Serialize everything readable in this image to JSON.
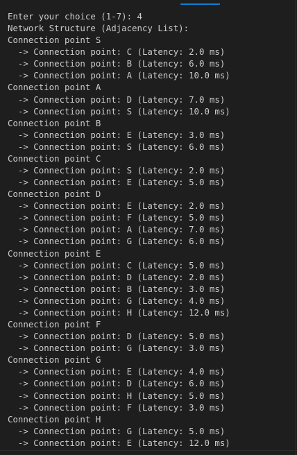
{
  "terminal": {
    "lines": [
      "Enter your choice (1-7): 4",
      "Network Structure (Adjacency List):",
      "Connection point S",
      "  -> Connection point: C (Latency: 2.0 ms)",
      "  -> Connection point: B (Latency: 6.0 ms)",
      "  -> Connection point: A (Latency: 10.0 ms)",
      "Connection point A",
      "  -> Connection point: D (Latency: 7.0 ms)",
      "  -> Connection point: S (Latency: 10.0 ms)",
      "Connection point B",
      "  -> Connection point: E (Latency: 3.0 ms)",
      "  -> Connection point: S (Latency: 6.0 ms)",
      "Connection point C",
      "  -> Connection point: S (Latency: 2.0 ms)",
      "  -> Connection point: E (Latency: 5.0 ms)",
      "Connection point D",
      "  -> Connection point: E (Latency: 2.0 ms)",
      "  -> Connection point: F (Latency: 5.0 ms)",
      "  -> Connection point: A (Latency: 7.0 ms)",
      "  -> Connection point: G (Latency: 6.0 ms)",
      "Connection point E",
      "  -> Connection point: C (Latency: 5.0 ms)",
      "  -> Connection point: D (Latency: 2.0 ms)",
      "  -> Connection point: B (Latency: 3.0 ms)",
      "  -> Connection point: G (Latency: 4.0 ms)",
      "  -> Connection point: H (Latency: 12.0 ms)",
      "Connection point F",
      "  -> Connection point: D (Latency: 5.0 ms)",
      "  -> Connection point: G (Latency: 3.0 ms)",
      "Connection point G",
      "  -> Connection point: E (Latency: 4.0 ms)",
      "  -> Connection point: D (Latency: 6.0 ms)",
      "  -> Connection point: H (Latency: 5.0 ms)",
      "  -> Connection point: F (Latency: 3.0 ms)",
      "Connection point H",
      "  -> Connection point: G (Latency: 5.0 ms)",
      "  -> Connection point: E (Latency: 12.0 ms)"
    ]
  },
  "colors": {
    "background": "#1e1e1e",
    "text": "#cccccc",
    "accent": "#0e7fd1"
  }
}
